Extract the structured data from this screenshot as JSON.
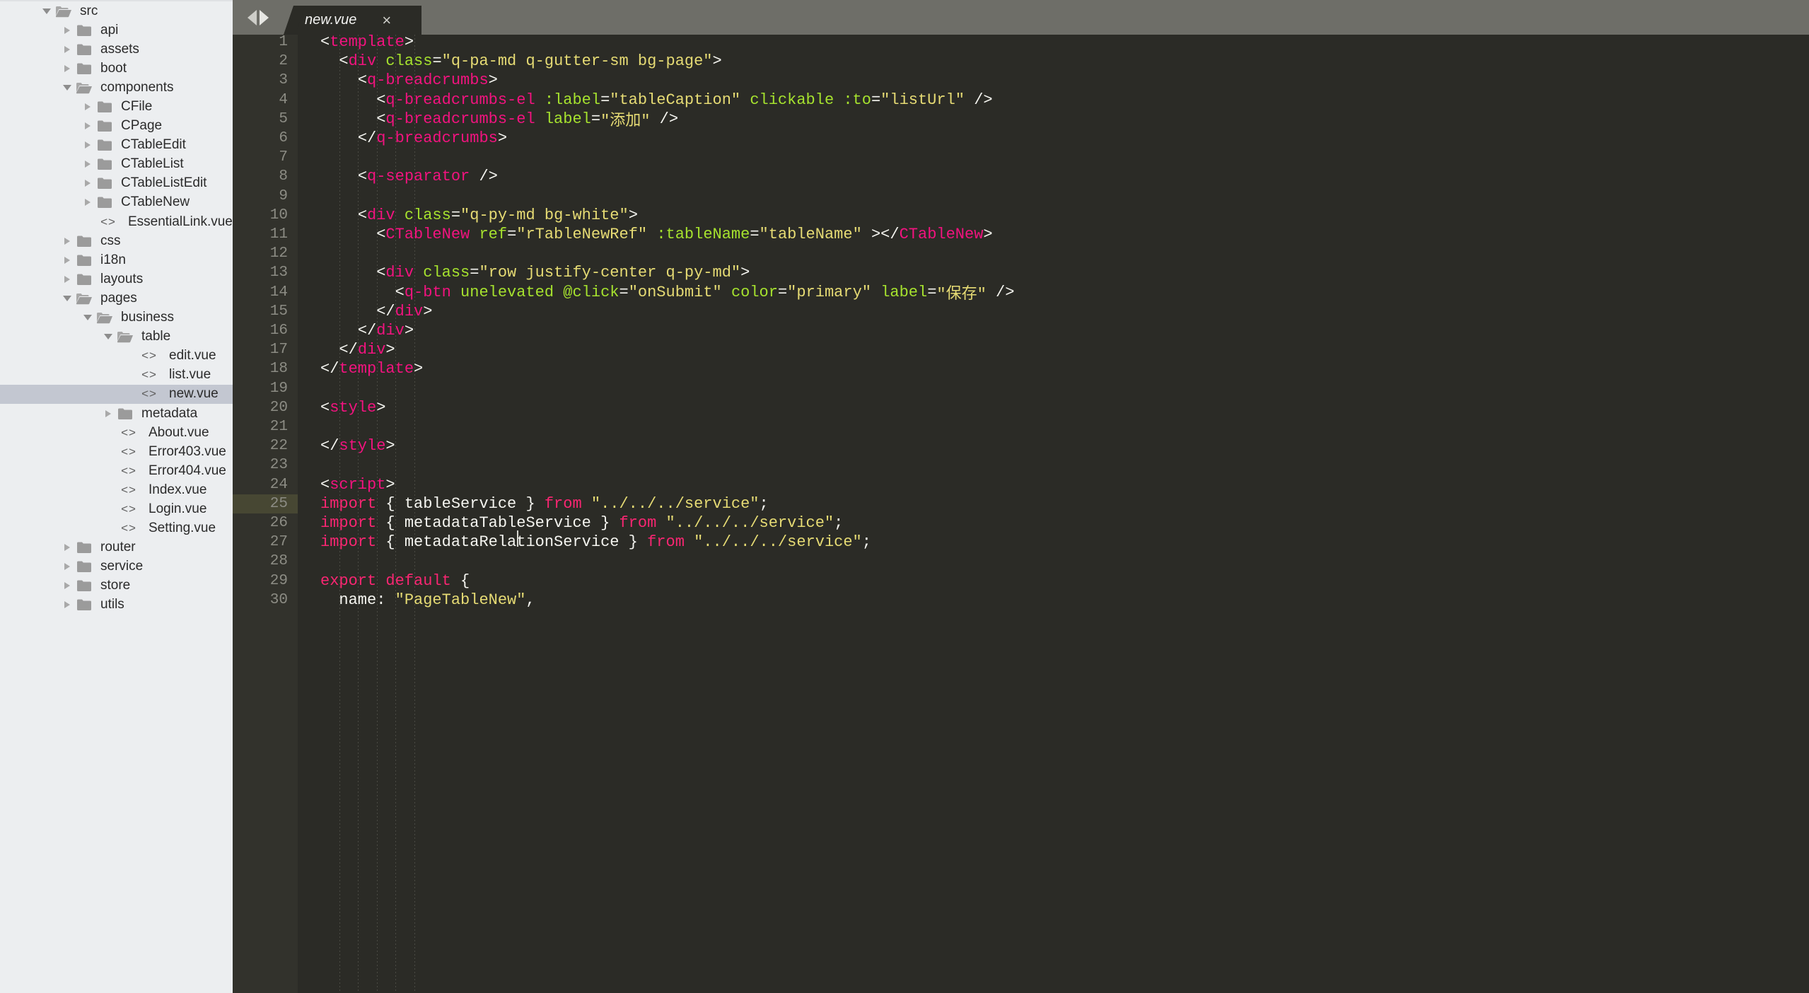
{
  "sidebar": {
    "tree": [
      {
        "label": "src",
        "type": "folder-open",
        "depth": 1,
        "twisty": "down",
        "selected": false
      },
      {
        "label": "api",
        "type": "folder",
        "depth": 2,
        "twisty": "right",
        "selected": false
      },
      {
        "label": "assets",
        "type": "folder",
        "depth": 2,
        "twisty": "right",
        "selected": false
      },
      {
        "label": "boot",
        "type": "folder",
        "depth": 2,
        "twisty": "right",
        "selected": false
      },
      {
        "label": "components",
        "type": "folder-open",
        "depth": 2,
        "twisty": "down",
        "selected": false
      },
      {
        "label": "CFile",
        "type": "folder",
        "depth": 3,
        "twisty": "right",
        "selected": false
      },
      {
        "label": "CPage",
        "type": "folder",
        "depth": 3,
        "twisty": "right",
        "selected": false
      },
      {
        "label": "CTableEdit",
        "type": "folder",
        "depth": 3,
        "twisty": "right",
        "selected": false
      },
      {
        "label": "CTableList",
        "type": "folder",
        "depth": 3,
        "twisty": "right",
        "selected": false
      },
      {
        "label": "CTableListEdit",
        "type": "folder",
        "depth": 3,
        "twisty": "right",
        "selected": false
      },
      {
        "label": "CTableNew",
        "type": "folder",
        "depth": 3,
        "twisty": "right",
        "selected": false
      },
      {
        "label": "EssentialLink.vue",
        "type": "code",
        "depth": 3,
        "twisty": "none",
        "selected": false
      },
      {
        "label": "css",
        "type": "folder",
        "depth": 2,
        "twisty": "right",
        "selected": false
      },
      {
        "label": "i18n",
        "type": "folder",
        "depth": 2,
        "twisty": "right",
        "selected": false
      },
      {
        "label": "layouts",
        "type": "folder",
        "depth": 2,
        "twisty": "right",
        "selected": false
      },
      {
        "label": "pages",
        "type": "folder-open",
        "depth": 2,
        "twisty": "down",
        "selected": false
      },
      {
        "label": "business",
        "type": "folder-open",
        "depth": 3,
        "twisty": "down",
        "selected": false
      },
      {
        "label": "table",
        "type": "folder-open",
        "depth": 4,
        "twisty": "down",
        "selected": false
      },
      {
        "label": "edit.vue",
        "type": "code",
        "depth": 5,
        "twisty": "none",
        "selected": false
      },
      {
        "label": "list.vue",
        "type": "code",
        "depth": 5,
        "twisty": "none",
        "selected": false
      },
      {
        "label": "new.vue",
        "type": "code",
        "depth": 5,
        "twisty": "none",
        "selected": true
      },
      {
        "label": "metadata",
        "type": "folder",
        "depth": 4,
        "twisty": "right",
        "selected": false
      },
      {
        "label": "About.vue",
        "type": "code",
        "depth": 4,
        "twisty": "none",
        "selected": false
      },
      {
        "label": "Error403.vue",
        "type": "code",
        "depth": 4,
        "twisty": "none",
        "selected": false
      },
      {
        "label": "Error404.vue",
        "type": "code",
        "depth": 4,
        "twisty": "none",
        "selected": false
      },
      {
        "label": "Index.vue",
        "type": "code",
        "depth": 4,
        "twisty": "none",
        "selected": false
      },
      {
        "label": "Login.vue",
        "type": "code",
        "depth": 4,
        "twisty": "none",
        "selected": false
      },
      {
        "label": "Setting.vue",
        "type": "code",
        "depth": 4,
        "twisty": "none",
        "selected": false
      },
      {
        "label": "router",
        "type": "folder",
        "depth": 2,
        "twisty": "right",
        "selected": false
      },
      {
        "label": "service",
        "type": "folder",
        "depth": 2,
        "twisty": "right",
        "selected": false
      },
      {
        "label": "store",
        "type": "folder",
        "depth": 2,
        "twisty": "right",
        "selected": false
      },
      {
        "label": "utils",
        "type": "folder",
        "depth": 2,
        "twisty": "right",
        "selected": false
      }
    ]
  },
  "editor": {
    "tab": {
      "title": "new.vue",
      "close_label": "×"
    },
    "nav": {
      "back_label": "back-arrow",
      "forward_label": "forward-arrow"
    },
    "active_line": 25,
    "lines": [
      {
        "n": 1,
        "indent": 0,
        "tokens": [
          {
            "t": "<",
            "c": "punc"
          },
          {
            "t": "template",
            "c": "tag"
          },
          {
            "t": ">",
            "c": "punc"
          }
        ]
      },
      {
        "n": 2,
        "indent": 1,
        "tokens": [
          {
            "t": "<",
            "c": "punc"
          },
          {
            "t": "div",
            "c": "tag"
          },
          {
            "t": " ",
            "c": "plain"
          },
          {
            "t": "class",
            "c": "attr"
          },
          {
            "t": "=",
            "c": "punc"
          },
          {
            "t": "\"q-pa-md q-gutter-sm bg-page\"",
            "c": "str"
          },
          {
            "t": ">",
            "c": "punc"
          }
        ]
      },
      {
        "n": 3,
        "indent": 2,
        "tokens": [
          {
            "t": "<",
            "c": "punc"
          },
          {
            "t": "q-breadcrumbs",
            "c": "tag"
          },
          {
            "t": ">",
            "c": "punc"
          }
        ]
      },
      {
        "n": 4,
        "indent": 3,
        "tokens": [
          {
            "t": "<",
            "c": "punc"
          },
          {
            "t": "q-breadcrumbs-el",
            "c": "tag"
          },
          {
            "t": " ",
            "c": "plain"
          },
          {
            "t": ":label",
            "c": "attr"
          },
          {
            "t": "=",
            "c": "punc"
          },
          {
            "t": "\"tableCaption\"",
            "c": "str"
          },
          {
            "t": " ",
            "c": "plain"
          },
          {
            "t": "clickable",
            "c": "attr"
          },
          {
            "t": " ",
            "c": "plain"
          },
          {
            "t": ":to",
            "c": "attr"
          },
          {
            "t": "=",
            "c": "punc"
          },
          {
            "t": "\"listUrl\"",
            "c": "str"
          },
          {
            "t": " />",
            "c": "punc"
          }
        ]
      },
      {
        "n": 5,
        "indent": 3,
        "tokens": [
          {
            "t": "<",
            "c": "punc"
          },
          {
            "t": "q-breadcrumbs-el",
            "c": "tag"
          },
          {
            "t": " ",
            "c": "plain"
          },
          {
            "t": "label",
            "c": "attr"
          },
          {
            "t": "=",
            "c": "punc"
          },
          {
            "t": "\"添加\"",
            "c": "str"
          },
          {
            "t": " />",
            "c": "punc"
          }
        ]
      },
      {
        "n": 6,
        "indent": 2,
        "tokens": [
          {
            "t": "</",
            "c": "punc"
          },
          {
            "t": "q-breadcrumbs",
            "c": "tag"
          },
          {
            "t": ">",
            "c": "punc"
          }
        ]
      },
      {
        "n": 7,
        "indent": 0,
        "tokens": []
      },
      {
        "n": 8,
        "indent": 2,
        "tokens": [
          {
            "t": "<",
            "c": "punc"
          },
          {
            "t": "q-separator",
            "c": "tag"
          },
          {
            "t": " />",
            "c": "punc"
          }
        ]
      },
      {
        "n": 9,
        "indent": 0,
        "tokens": []
      },
      {
        "n": 10,
        "indent": 2,
        "tokens": [
          {
            "t": "<",
            "c": "punc"
          },
          {
            "t": "div",
            "c": "tag"
          },
          {
            "t": " ",
            "c": "plain"
          },
          {
            "t": "class",
            "c": "attr"
          },
          {
            "t": "=",
            "c": "punc"
          },
          {
            "t": "\"q-py-md bg-white\"",
            "c": "str"
          },
          {
            "t": ">",
            "c": "punc"
          }
        ]
      },
      {
        "n": 11,
        "indent": 3,
        "tokens": [
          {
            "t": "<",
            "c": "punc"
          },
          {
            "t": "CTableNew",
            "c": "comp"
          },
          {
            "t": " ",
            "c": "plain"
          },
          {
            "t": "ref",
            "c": "attr"
          },
          {
            "t": "=",
            "c": "punc"
          },
          {
            "t": "\"rTableNewRef\"",
            "c": "str"
          },
          {
            "t": " ",
            "c": "plain"
          },
          {
            "t": ":tableName",
            "c": "attr"
          },
          {
            "t": "=",
            "c": "punc"
          },
          {
            "t": "\"tableName\"",
            "c": "str"
          },
          {
            "t": " ></",
            "c": "punc"
          },
          {
            "t": "CTableNew",
            "c": "comp"
          },
          {
            "t": ">",
            "c": "punc"
          }
        ]
      },
      {
        "n": 12,
        "indent": 0,
        "tokens": []
      },
      {
        "n": 13,
        "indent": 3,
        "tokens": [
          {
            "t": "<",
            "c": "punc"
          },
          {
            "t": "div",
            "c": "tag"
          },
          {
            "t": " ",
            "c": "plain"
          },
          {
            "t": "class",
            "c": "attr"
          },
          {
            "t": "=",
            "c": "punc"
          },
          {
            "t": "\"row justify-center q-py-md\"",
            "c": "str"
          },
          {
            "t": ">",
            "c": "punc"
          }
        ]
      },
      {
        "n": 14,
        "indent": 4,
        "tokens": [
          {
            "t": "<",
            "c": "punc"
          },
          {
            "t": "q-btn",
            "c": "tag"
          },
          {
            "t": " ",
            "c": "plain"
          },
          {
            "t": "unelevated",
            "c": "attr"
          },
          {
            "t": " ",
            "c": "plain"
          },
          {
            "t": "@click",
            "c": "attr"
          },
          {
            "t": "=",
            "c": "punc"
          },
          {
            "t": "\"onSubmit\"",
            "c": "str"
          },
          {
            "t": " ",
            "c": "plain"
          },
          {
            "t": "color",
            "c": "attr"
          },
          {
            "t": "=",
            "c": "punc"
          },
          {
            "t": "\"primary\"",
            "c": "str"
          },
          {
            "t": " ",
            "c": "plain"
          },
          {
            "t": "label",
            "c": "attr"
          },
          {
            "t": "=",
            "c": "punc"
          },
          {
            "t": "\"保存\"",
            "c": "str"
          },
          {
            "t": " />",
            "c": "punc"
          }
        ]
      },
      {
        "n": 15,
        "indent": 3,
        "tokens": [
          {
            "t": "</",
            "c": "punc"
          },
          {
            "t": "div",
            "c": "tag"
          },
          {
            "t": ">",
            "c": "punc"
          }
        ]
      },
      {
        "n": 16,
        "indent": 2,
        "tokens": [
          {
            "t": "</",
            "c": "punc"
          },
          {
            "t": "div",
            "c": "tag"
          },
          {
            "t": ">",
            "c": "punc"
          }
        ]
      },
      {
        "n": 17,
        "indent": 1,
        "tokens": [
          {
            "t": "</",
            "c": "punc"
          },
          {
            "t": "div",
            "c": "tag"
          },
          {
            "t": ">",
            "c": "punc"
          }
        ]
      },
      {
        "n": 18,
        "indent": 0,
        "tokens": [
          {
            "t": "</",
            "c": "punc"
          },
          {
            "t": "template",
            "c": "tag"
          },
          {
            "t": ">",
            "c": "punc"
          }
        ]
      },
      {
        "n": 19,
        "indent": 0,
        "tokens": []
      },
      {
        "n": 20,
        "indent": 0,
        "tokens": [
          {
            "t": "<",
            "c": "punc"
          },
          {
            "t": "style",
            "c": "tag"
          },
          {
            "t": ">",
            "c": "punc"
          }
        ]
      },
      {
        "n": 21,
        "indent": 0,
        "tokens": []
      },
      {
        "n": 22,
        "indent": 0,
        "tokens": [
          {
            "t": "</",
            "c": "punc"
          },
          {
            "t": "style",
            "c": "tag"
          },
          {
            "t": ">",
            "c": "punc"
          }
        ]
      },
      {
        "n": 23,
        "indent": 0,
        "tokens": []
      },
      {
        "n": 24,
        "indent": 0,
        "tokens": [
          {
            "t": "<",
            "c": "punc"
          },
          {
            "t": "script",
            "c": "tag"
          },
          {
            "t": ">",
            "c": "punc"
          }
        ]
      },
      {
        "n": 25,
        "indent": 0,
        "tokens": [
          {
            "t": "import",
            "c": "kw"
          },
          {
            "t": " { tableService } ",
            "c": "plain"
          },
          {
            "t": "from",
            "c": "kw"
          },
          {
            "t": " ",
            "c": "plain"
          },
          {
            "t": "\"../../../service\"",
            "c": "str"
          },
          {
            "t": ";",
            "c": "plain"
          }
        ]
      },
      {
        "n": 26,
        "indent": 0,
        "tokens": [
          {
            "t": "import",
            "c": "kw"
          },
          {
            "t": " { metadataTableService } ",
            "c": "plain"
          },
          {
            "t": "from",
            "c": "kw"
          },
          {
            "t": " ",
            "c": "plain"
          },
          {
            "t": "\"../../../service\"",
            "c": "str"
          },
          {
            "t": ";",
            "c": "plain"
          }
        ]
      },
      {
        "n": 27,
        "indent": 0,
        "tokens": [
          {
            "t": "import",
            "c": "kw"
          },
          {
            "t": " { metadataRelationService } ",
            "c": "plain"
          },
          {
            "t": "from",
            "c": "kw"
          },
          {
            "t": " ",
            "c": "plain"
          },
          {
            "t": "\"../../../service\"",
            "c": "str"
          },
          {
            "t": ";",
            "c": "plain"
          }
        ]
      },
      {
        "n": 28,
        "indent": 0,
        "tokens": []
      },
      {
        "n": 29,
        "indent": 0,
        "tokens": [
          {
            "t": "export default",
            "c": "kw"
          },
          {
            "t": " {",
            "c": "plain"
          }
        ]
      },
      {
        "n": 30,
        "indent": 1,
        "tokens": [
          {
            "t": "name",
            "c": "plain"
          },
          {
            "t": ": ",
            "c": "plain"
          },
          {
            "t": "\"PageTableNew\"",
            "c": "str"
          },
          {
            "t": ",",
            "c": "plain"
          }
        ]
      }
    ]
  },
  "colors": {
    "sidebar_bg": "#eceef0",
    "sidebar_selected": "#c3c7d1",
    "editor_bg": "#2b2b26",
    "gutter_bg": "#32322c",
    "tabbar_bg": "#6e6e68",
    "tag": "#f2137f",
    "attr": "#a6e22e",
    "string": "#e6db74",
    "keyword": "#f92672",
    "plain": "#f5f5f0",
    "linenum": "#8c8c84",
    "active_line_gutter": "#474733"
  }
}
